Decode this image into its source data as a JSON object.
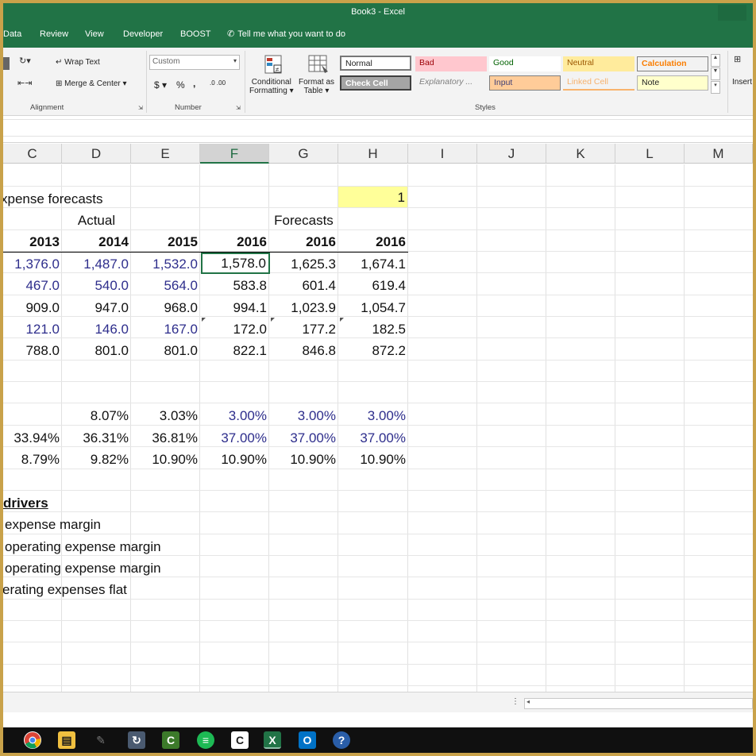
{
  "window": {
    "title": "Book3 - Excel"
  },
  "tabs": [
    "Data",
    "Review",
    "View",
    "Developer",
    "BOOST"
  ],
  "tell_me": "Tell me what you want to do",
  "ribbon": {
    "alignment": {
      "wrap_text": "Wrap Text",
      "merge_center": "Merge & Center",
      "group_label": "Alignment"
    },
    "number": {
      "format_value": "Custom",
      "currency": "$",
      "percent": "%",
      "comma": ",",
      "inc_decimal": ".0 .00",
      "dec_decimal": ".00 .0",
      "group_label": "Number"
    },
    "cond_format": {
      "line1": "Conditional",
      "line2": "Formatting"
    },
    "format_table": {
      "line1": "Format as",
      "line2": "Table"
    },
    "styles": {
      "items": [
        "Normal",
        "Bad",
        "Good",
        "Neutral",
        "Calculation",
        "Check Cell",
        "Explanatory ...",
        "Input",
        "Linked Cell",
        "Note"
      ],
      "group_label": "Styles"
    },
    "insert_label": "Insert"
  },
  "columns": [
    "C",
    "D",
    "E",
    "F",
    "G",
    "H",
    "I",
    "J",
    "K",
    "L",
    "M"
  ],
  "selected_column": "F",
  "sheet": {
    "title": "xpense forecasts",
    "scenario_value": "1",
    "actual_label": "Actual",
    "forecasts_label": "Forecasts",
    "years": [
      "2013",
      "2014",
      "2015",
      "2016",
      "2016",
      "2016"
    ],
    "rows": [
      [
        "1,376.0",
        "1,487.0",
        "1,532.0",
        "1,578.0",
        "1,625.3",
        "1,674.1"
      ],
      [
        "467.0",
        "540.0",
        "564.0",
        "583.8",
        "601.4",
        "619.4"
      ],
      [
        "909.0",
        "947.0",
        "968.0",
        "994.1",
        "1,023.9",
        "1,054.7"
      ],
      [
        "121.0",
        "146.0",
        "167.0",
        "172.0",
        "177.2",
        "182.5"
      ],
      [
        "788.0",
        "801.0",
        "801.0",
        "822.1",
        "846.8",
        "872.2"
      ]
    ],
    "ratios": [
      [
        "",
        "8.07%",
        "3.03%",
        "3.00%",
        "3.00%",
        "3.00%"
      ],
      [
        "33.94%",
        "36.31%",
        "36.81%",
        "37.00%",
        "37.00%",
        "37.00%"
      ],
      [
        "8.79%",
        "9.82%",
        "10.90%",
        "10.90%",
        "10.90%",
        "10.90%"
      ]
    ],
    "drivers_heading": "drivers",
    "drivers": [
      "expense margin",
      "operating expense margin",
      "operating expense margin",
      "erating expenses flat"
    ]
  },
  "taskbar": {
    "icons": [
      "chrome-icon",
      "file-explorer-icon",
      "pen-icon",
      "app-icon",
      "camtasia-icon",
      "spotify-icon",
      "camtasia-recorder-icon",
      "excel-icon",
      "outlook-icon",
      "help-icon"
    ]
  }
}
